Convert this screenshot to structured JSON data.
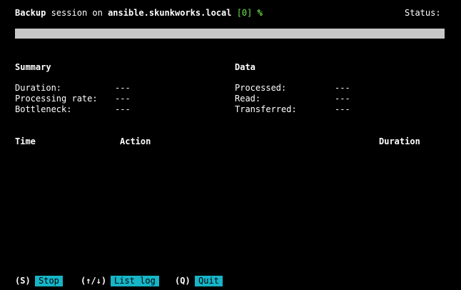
{
  "header": {
    "word_backup": "Backup",
    "word_session_on": "session on",
    "host": "ansible.skunkworks.local",
    "index": "[0]",
    "percent": "%",
    "status_label": "Status:"
  },
  "progress": {
    "fraction": 0.0
  },
  "summary": {
    "title": "Summary",
    "rows": [
      {
        "label": "Duration:",
        "value": "---"
      },
      {
        "label": "Processing rate:",
        "value": "---"
      },
      {
        "label": "Bottleneck:",
        "value": "---"
      }
    ]
  },
  "data_section": {
    "title": "Data",
    "rows": [
      {
        "label": "Processed:",
        "value": "---"
      },
      {
        "label": "Read:",
        "value": "---"
      },
      {
        "label": "Transferred:",
        "value": "---"
      }
    ]
  },
  "log_table": {
    "col_time": "Time",
    "col_action": "Action",
    "col_duration": "Duration"
  },
  "footer": {
    "stop_key": "(S)",
    "stop_label": "Stop",
    "list_key": "(↑/↓)",
    "list_label": "List log",
    "quit_key": "(Q)",
    "quit_label": "Quit"
  },
  "colors": {
    "background": "#000000",
    "accent_button": "#16b5c8",
    "index_green": "#6ee44a",
    "progress_bar": "#c8c8c8"
  }
}
